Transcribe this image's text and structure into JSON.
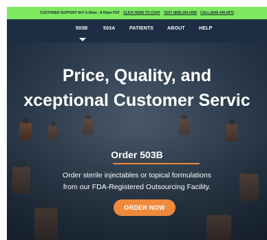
{
  "support_bar": {
    "hours": "CUSTOMER SUPPORT M-F 5:30am - 8:00pm PST",
    "chat_link": "CLICK HERE TO CHAT",
    "text": "TEXT (858) 264-2082",
    "call": "CALL (844) 446-6979"
  },
  "nav": {
    "items": [
      {
        "label": "503B"
      },
      {
        "label": "503A"
      },
      {
        "label": "PATIENTS"
      },
      {
        "label": "ABOUT"
      },
      {
        "label": "HELP"
      }
    ]
  },
  "hero": {
    "title_line1": "Price, Quality, and",
    "title_line2": "xceptional Customer Servic",
    "section_title": "Order 503B",
    "desc_line1": "Order sterile injectables or topical formulations",
    "desc_line2": "from our FDA-Registered Outsourcing Facility.",
    "cta_label": "ORDER NOW"
  },
  "colors": {
    "support_bar": "#7ee85f",
    "nav_bg": "#1d2e44",
    "accent": "#ee8a3c"
  }
}
